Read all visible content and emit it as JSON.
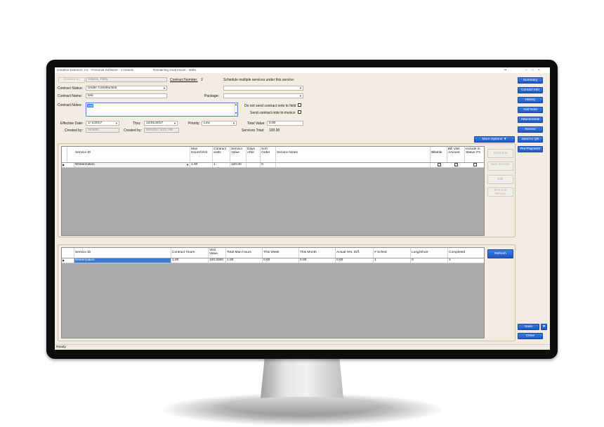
{
  "window": {
    "title": "Creative Exteriors, Inc - Personal Software - Contacts",
    "remaining": "Remaining Goal Hours - 3060",
    "dots": "••",
    "status": "Ready"
  },
  "header": {
    "contact_btn": "Contact ID",
    "contact_name": "Adams, Patty",
    "contract_number_label": "Contract Number:",
    "contract_number": "2",
    "schedule_label": "Schedule multiple services under this service:",
    "contract_status_label": "Contract Status:",
    "contract_status": "Under Construction",
    "contract_name_label": "Contract Name:",
    "contract_name": "test",
    "package_label": "Package:",
    "contract_notes_label": "Contract Notes:",
    "contract_notes": "test",
    "no_send_field": "Do not send contract note to field",
    "send_invoice": "Send contract note to invoice",
    "effective_label": "Effective Date:",
    "effective_date": "1/ 1/2017",
    "thru_label": "Thru:",
    "thru_date": "12/31/2017",
    "priority_label": "Priority:",
    "priority": "Low",
    "total_value_label": "Total Value:",
    "total_value": "0.00",
    "created_by_label": "Created by:",
    "created_by": "ADMIN",
    "created_at_label": "Created by:",
    "created_at": "5/1/2017 9:41 AM",
    "services_total_label": "Services Total:",
    "services_total": "100.00",
    "more_options": "More Options"
  },
  "services_grid": {
    "columns": [
      "Service ID",
      "Man Hours/Visit",
      "Contract visits",
      "Service Value",
      "Days After",
      "Sort Order",
      "Service Notes",
      "Billable",
      "Bill Visit Amount",
      "Include in Status #'s"
    ],
    "rows": [
      {
        "service_id": "Winterization",
        "man_hours": "1.00",
        "visits": "1",
        "value": "100.00",
        "days_after": "",
        "sort_order": "0",
        "notes": "",
        "billable": true,
        "bill_visit": true,
        "include": false
      }
    ]
  },
  "service_buttons": [
    "Schedule",
    "New Service",
    "Edit",
    "Remove Service"
  ],
  "summary_grid": {
    "columns": [
      "Service ID",
      "Contract Hours",
      "Visit Value",
      "Total Man Hours",
      "This Week",
      "This Month",
      "Actual Hrs. Diff.",
      "# Sched",
      "Long/Short",
      "Completed"
    ],
    "rows": [
      {
        "service_id": "Winterization",
        "contract_hours": "1.00",
        "visit_value": "100.0000",
        "total_man_hours": "1.00",
        "this_week": "0.00",
        "this_month": "0.00",
        "diff": "0.00",
        "sched": "1",
        "long_short": "0",
        "completed": "1"
      }
    ]
  },
  "refresh": "Refresh",
  "right_nav": [
    "Summary",
    "Contact Info",
    "History",
    "Add Note",
    "Attachments",
    "Renew",
    "Send to QB",
    "Pre-Payment"
  ],
  "save": "Save",
  "close": "Close",
  "colors": {
    "accent": "#2a66d0",
    "panel": "#f3ece3",
    "grid_empty": "#aaaaaa"
  }
}
